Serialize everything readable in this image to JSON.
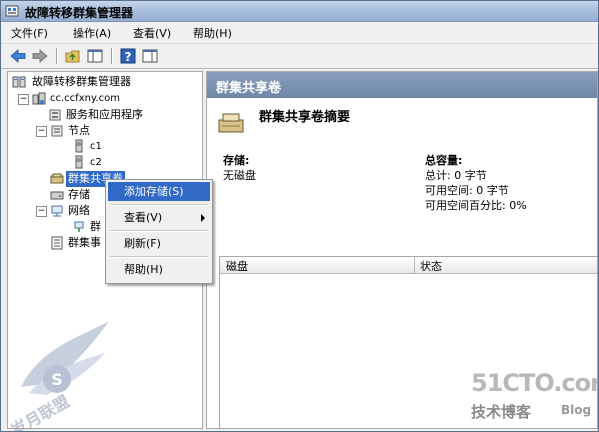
{
  "window": {
    "title": "故障转移群集管理器"
  },
  "menu": [
    "文件(F)",
    "操作(A)",
    "查看(V)",
    "帮助(H)"
  ],
  "toolbar": {
    "buttons": [
      "back-icon",
      "forward-icon",
      "up-folder-icon",
      "show-hide-tree-icon",
      "help-icon",
      "action-pane-icon"
    ]
  },
  "tree": {
    "root": "故障转移群集管理器",
    "cluster": "cc.ccfxny.com",
    "services": "服务和应用程序",
    "nodes": "节点",
    "node1": "c1",
    "node2": "c2",
    "csv": "群集共享卷",
    "storage": "存储",
    "network": "网络",
    "network_child": "群",
    "events": "群集事"
  },
  "context_menu": {
    "add_storage": "添加存储(S)",
    "view": "查看(V)",
    "refresh": "刷新(F)",
    "help": "帮助(H)"
  },
  "right": {
    "header": "群集共享卷",
    "summary_title": "群集共享卷摘要",
    "storage_label": "存储:",
    "storage_value": "无磁盘",
    "capacity_label": "总容量:",
    "total": "总计: 0 字节",
    "free": "可用空间: 0 字节",
    "free_pct": "可用空间百分比: 0%",
    "columns": [
      "磁盘",
      "状态"
    ]
  },
  "watermarks": {
    "site": "51CTO.com",
    "tagline": "技术博客",
    "blog": "Blog"
  }
}
